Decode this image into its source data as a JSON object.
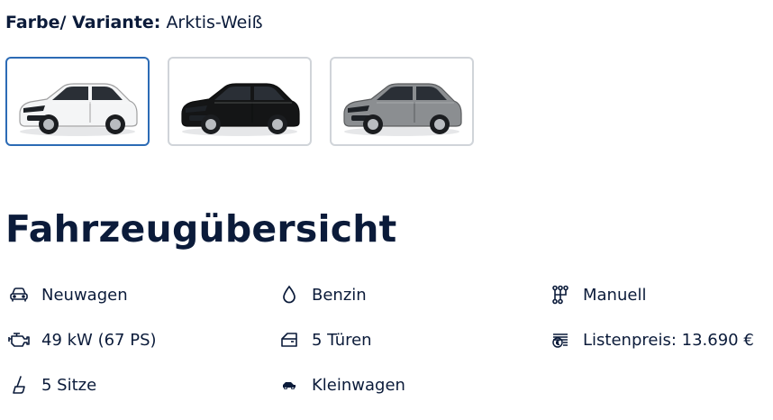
{
  "variant": {
    "label": "Farbe/ Variante:",
    "value": "Arktis-Weiß",
    "swatches": [
      {
        "name": "Arktis-Weiß",
        "color": "#f4f5f6",
        "selected": true
      },
      {
        "name": "Schwarz",
        "color": "#141516",
        "selected": false
      },
      {
        "name": "Grau",
        "color": "#8b8e91",
        "selected": false
      }
    ]
  },
  "overview": {
    "title": "Fahrzeugübersicht",
    "specs": [
      {
        "icon": "car-front-icon",
        "text": "Neuwagen"
      },
      {
        "icon": "fuel-drop-icon",
        "text": "Benzin"
      },
      {
        "icon": "gearshift-icon",
        "text": "Manuell"
      },
      {
        "icon": "engine-icon",
        "text": "49 kW (67 PS)"
      },
      {
        "icon": "car-door-icon",
        "text": "5 Türen"
      },
      {
        "icon": "price-tag-icon",
        "text": "Listenpreis: 13.690 €"
      },
      {
        "icon": "car-seat-icon",
        "text": "5 Sitze"
      },
      {
        "icon": "small-car-icon",
        "text": "Kleinwagen"
      }
    ]
  },
  "colors": {
    "text": "#0b1b3a",
    "selected_border": "#2c6bb5",
    "swatch_border": "#d0d4d9"
  }
}
